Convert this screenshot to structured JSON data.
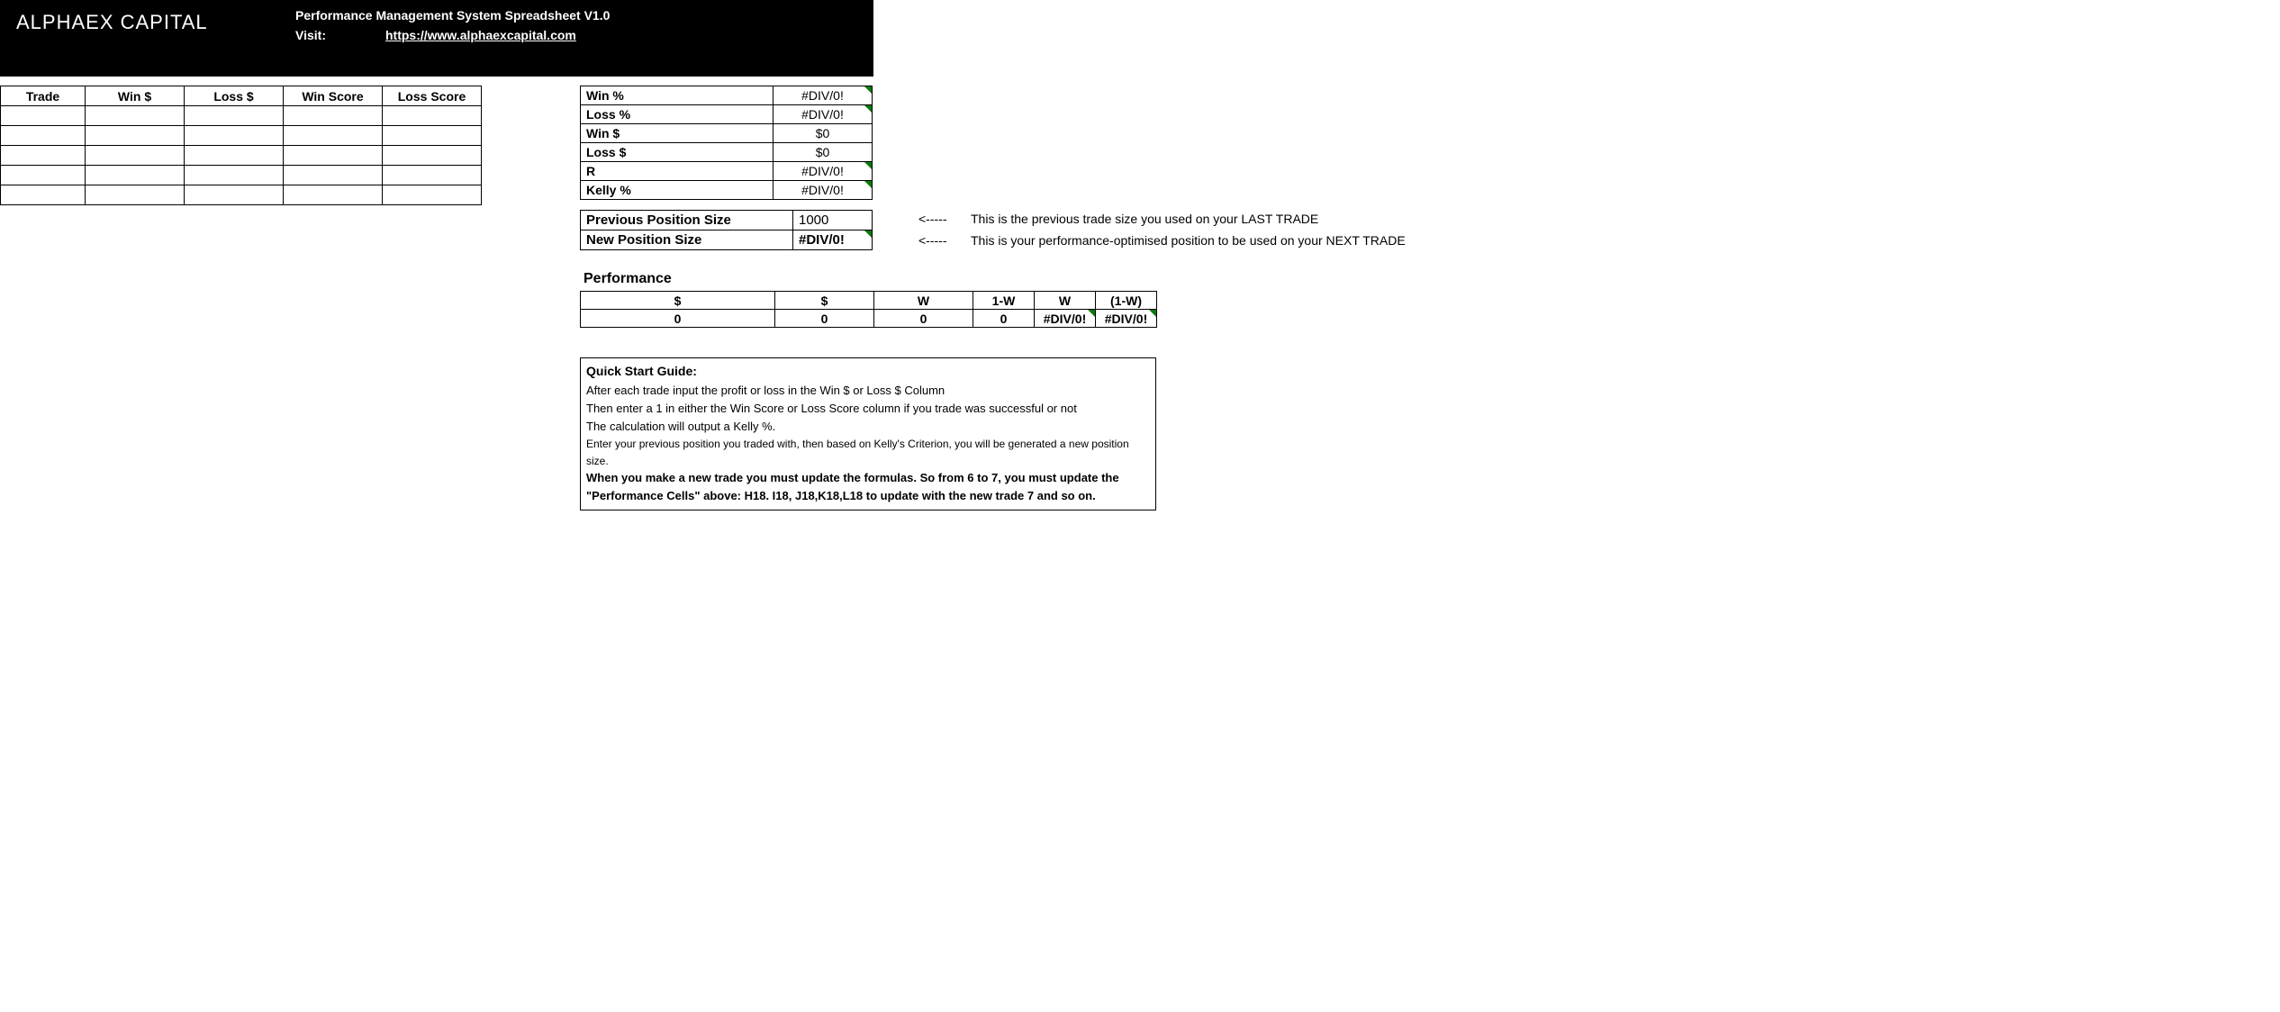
{
  "header": {
    "brand": "ALPHAEX CAPITAL",
    "title": "Performance Management System Spreadsheet V1.0",
    "visit_label": "Visit:",
    "link": "https://www.alphaexcapital.com"
  },
  "trade_table": {
    "headers": [
      "Trade",
      "Win $",
      "Loss $",
      "Win Score",
      "Loss Score"
    ],
    "rows": [
      [
        "",
        "",
        "",
        "",
        ""
      ],
      [
        "",
        "",
        "",
        "",
        ""
      ],
      [
        "",
        "",
        "",
        "",
        ""
      ],
      [
        "",
        "",
        "",
        "",
        ""
      ],
      [
        "",
        "",
        "",
        "",
        ""
      ]
    ]
  },
  "stats": [
    {
      "label": "Win %",
      "value": "#DIV/0!",
      "tri": true
    },
    {
      "label": "Loss %",
      "value": "#DIV/0!",
      "tri": true
    },
    {
      "label": "Win $",
      "value": "$0",
      "tri": false
    },
    {
      "label": "Loss $",
      "value": "$0",
      "tri": false
    },
    {
      "label": "R",
      "value": "#DIV/0!",
      "tri": true
    },
    {
      "label": "Kelly %",
      "value": "#DIV/0!",
      "tri": true
    }
  ],
  "position": {
    "prev_label": "Previous Position Size",
    "prev_value": "1000",
    "new_label": "New Position Size",
    "new_value": "#DIV/0!"
  },
  "arrows": {
    "symbol": "<-----",
    "note1": "This is the previous trade size you used on your LAST TRADE",
    "note2": "This is your performance-optimised position to be used on your NEXT TRADE"
  },
  "performance": {
    "title": "Performance",
    "headers": [
      "$",
      "$",
      "W",
      "1-W",
      "W",
      "(1-W)"
    ],
    "values": [
      "0",
      "0",
      "0",
      "0",
      "#DIV/0!",
      "#DIV/0!"
    ],
    "tri": [
      false,
      false,
      false,
      false,
      true,
      true
    ]
  },
  "guide": {
    "title": "Quick Start Guide:",
    "line1": "After each trade input the profit or loss in the Win $ or Loss $ Column",
    "line2": "Then enter a 1 in either the Win Score or Loss Score column if you trade was successful or not",
    "line3": "The calculation will output a Kelly %.",
    "line4": "Enter your previous position you traded with, then based on Kelly's Criterion, you will be generated a new position size.",
    "line5": "When you make a new trade you must update the formulas. So from 6 to 7, you must update the \"Performance Cells\" above: H18. I18, J18,K18,L18 to update with the new trade 7 and so on."
  }
}
